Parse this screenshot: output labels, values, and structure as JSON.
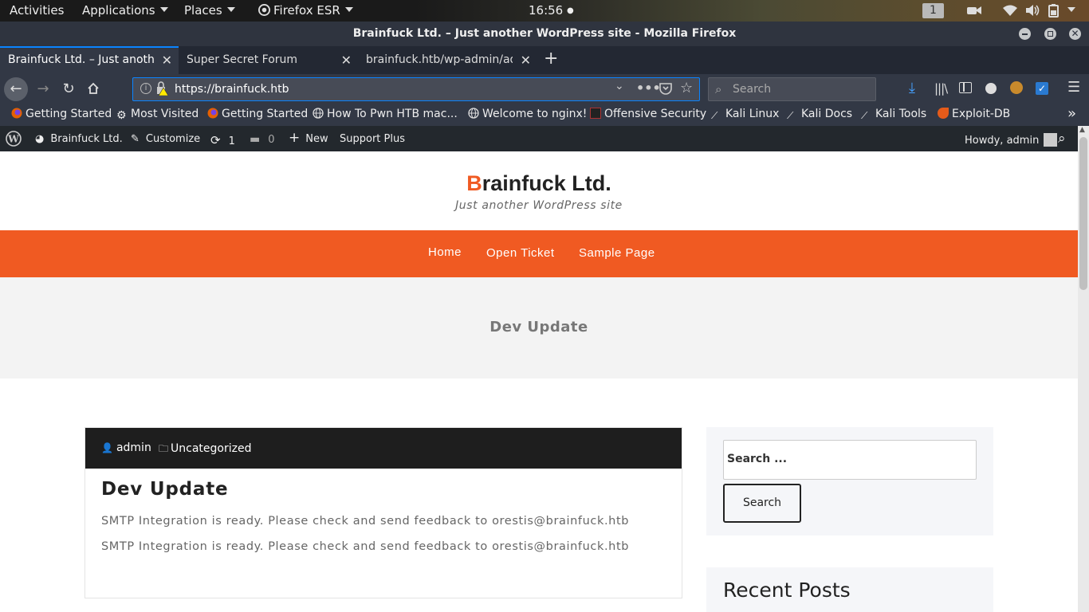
{
  "gnome": {
    "activities": "Activities",
    "applications": "Applications",
    "places": "Places",
    "firefox": "Firefox ESR",
    "clock": "16:56",
    "workspace": "1"
  },
  "window": {
    "title": "Brainfuck Ltd. – Just another WordPress site - Mozilla Firefox"
  },
  "tabs": [
    {
      "label": "Brainfuck Ltd. – Just another WordPress site"
    },
    {
      "label": "Super Secret Forum"
    },
    {
      "label": "brainfuck.htb/wp-admin/admin.php"
    }
  ],
  "nav": {
    "url": "https://brainfuck.htb",
    "search_placeholder": "Search"
  },
  "bookmarks": [
    {
      "label": "Getting Started",
      "icon": "firefox-icon"
    },
    {
      "label": "Most Visited",
      "icon": "gear-icon"
    },
    {
      "label": "Getting Started",
      "icon": "firefox-icon"
    },
    {
      "label": "How To Pwn HTB mac...",
      "icon": "globe-icon"
    },
    {
      "label": "Welcome to nginx!",
      "icon": "globe-icon"
    },
    {
      "label": "Offensive Security",
      "icon": "offsec-icon"
    },
    {
      "label": "Kali Linux",
      "icon": "kali-icon"
    },
    {
      "label": "Kali Docs",
      "icon": "kali-icon"
    },
    {
      "label": "Kali Tools",
      "icon": "kali-icon"
    },
    {
      "label": "Exploit-DB",
      "icon": "exploitdb-icon"
    }
  ],
  "wpbar": {
    "site": "Brainfuck Ltd.",
    "customize": "Customize",
    "updates": "1",
    "comments": "0",
    "new": "New",
    "support": "Support Plus",
    "howdy": "Howdy, admin"
  },
  "site": {
    "title_first": "B",
    "title_rest": "rainfuck Ltd.",
    "tagline": "Just another WordPress site",
    "menu": [
      "Home",
      "Open Ticket",
      "Sample Page"
    ],
    "banner_title": "Dev Update"
  },
  "post": {
    "author": "admin",
    "category": "Uncategorized",
    "title": "Dev Update",
    "lines": [
      "SMTP Integration is ready. Please check and send feedback to orestis@brainfuck.htb",
      "SMTP Integration is ready. Please check and send feedback to orestis@brainfuck.htb"
    ]
  },
  "sidebar": {
    "search_placeholder": "Search ...",
    "search_button": "Search",
    "recent_posts": "Recent Posts"
  },
  "colors": {
    "accent": "#f05a22",
    "wp_admin_bar": "#23282d",
    "firefox_dark": "#323845"
  }
}
